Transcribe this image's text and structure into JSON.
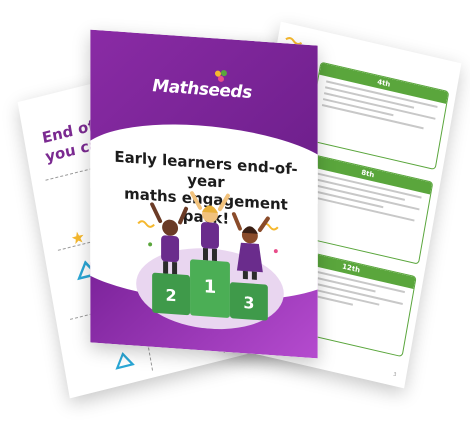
{
  "cover": {
    "brand_logo": "Mathseeds",
    "headline_line1": "Early learners end-of-year",
    "headline_line2": "maths engagement pack!",
    "podium_first": "1",
    "podium_second": "2",
    "podium_third": "3"
  },
  "worksheet": {
    "title_line1": "End of year",
    "title_line2": "you cards"
  },
  "answer_sheet": {
    "cards": [
      {
        "heading": "4th"
      },
      {
        "heading": "8th"
      },
      {
        "heading": "12th"
      }
    ],
    "page_number": "3"
  },
  "colors": {
    "brand_purple": "#7b2a91",
    "accent_green": "#5aa63c",
    "podium_green": "#3f9a4a",
    "student_purple": "#6a2c8c"
  },
  "icons": [
    "rocket-icon",
    "star-icon",
    "triangle-icon",
    "confetti-icon",
    "snowflake-icon"
  ]
}
